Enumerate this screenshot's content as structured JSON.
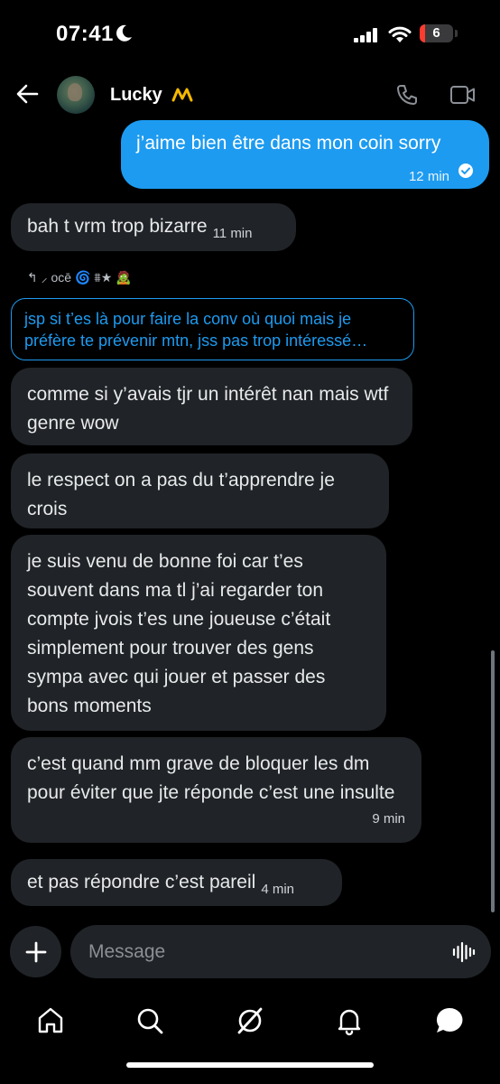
{
  "status_bar": {
    "time": "07:41",
    "battery_level": "6"
  },
  "header": {
    "contact_name": "Lucky",
    "name_emoji": "〽️"
  },
  "messages": [
    {
      "side": "sent",
      "text": "j’aime bien être dans mon coin sorry",
      "time": "12 min"
    },
    {
      "side": "received",
      "text": "bah t vrm trop bizarre",
      "time": "11 min"
    },
    {
      "side": "received",
      "text": "comme si y’avais tjr un intérêt nan mais wtf genre wow"
    },
    {
      "side": "received",
      "text": "le respect on a pas du t’apprendre je crois"
    },
    {
      "side": "received",
      "text": "je suis venu de bonne foi car t’es souvent dans ma tl j’ai regarder ton compte jvois t’es une joueuse c’était simplement pour trouver des gens sympa avec qui jouer et passer des bons moments"
    },
    {
      "side": "received",
      "text": "c’est quand mm grave de bloquer les dm pour éviter que jte réponde c’est une insulte",
      "time": "9 min"
    },
    {
      "side": "received",
      "text": "et pas répondre c’est pareil",
      "time": "4 min"
    }
  ],
  "reply": {
    "author": "↰ ⸝ ᴏᴄē 🌀 ⩩★ 🧟",
    "quoted_text": "jsp si t’es là pour faire la conv où quoi mais je préfère te prévenir mtn, jss pas trop intéressé…"
  },
  "composer": {
    "placeholder": "Message"
  },
  "colors": {
    "background": "#000000",
    "sent_bubble": "#1d9bf0",
    "received_bubble": "#202327",
    "reply_border": "#1d9bf0"
  },
  "nav": [
    "home-icon",
    "search-icon",
    "grok-icon",
    "notifications-icon",
    "messages-icon"
  ]
}
